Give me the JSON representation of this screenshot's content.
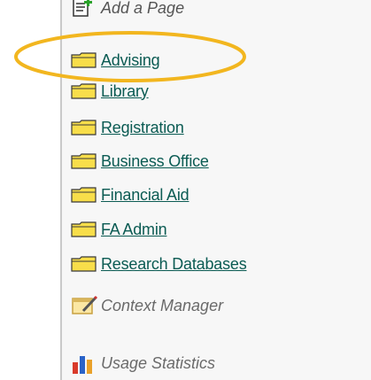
{
  "add_page": {
    "label": "Add a Page"
  },
  "folders": [
    {
      "label": "Advising"
    },
    {
      "label": "Library"
    },
    {
      "label": "Registration"
    },
    {
      "label": "Business Office"
    },
    {
      "label": "Financial Aid"
    },
    {
      "label": "FA Admin"
    },
    {
      "label": "Research Databases"
    }
  ],
  "tools": {
    "context_manager": "Context Manager",
    "usage_statistics": "Usage Statistics"
  },
  "colors": {
    "link": "#0b5b53",
    "highlight": "#f2b61f",
    "folder_fill": "#f8de4a",
    "folder_edge": "#3a3a3a"
  },
  "icons": {
    "add_page": "add-page-icon",
    "folder": "folder-icon",
    "context_manager": "pencil-note-icon",
    "usage_statistics": "bar-chart-icon"
  }
}
